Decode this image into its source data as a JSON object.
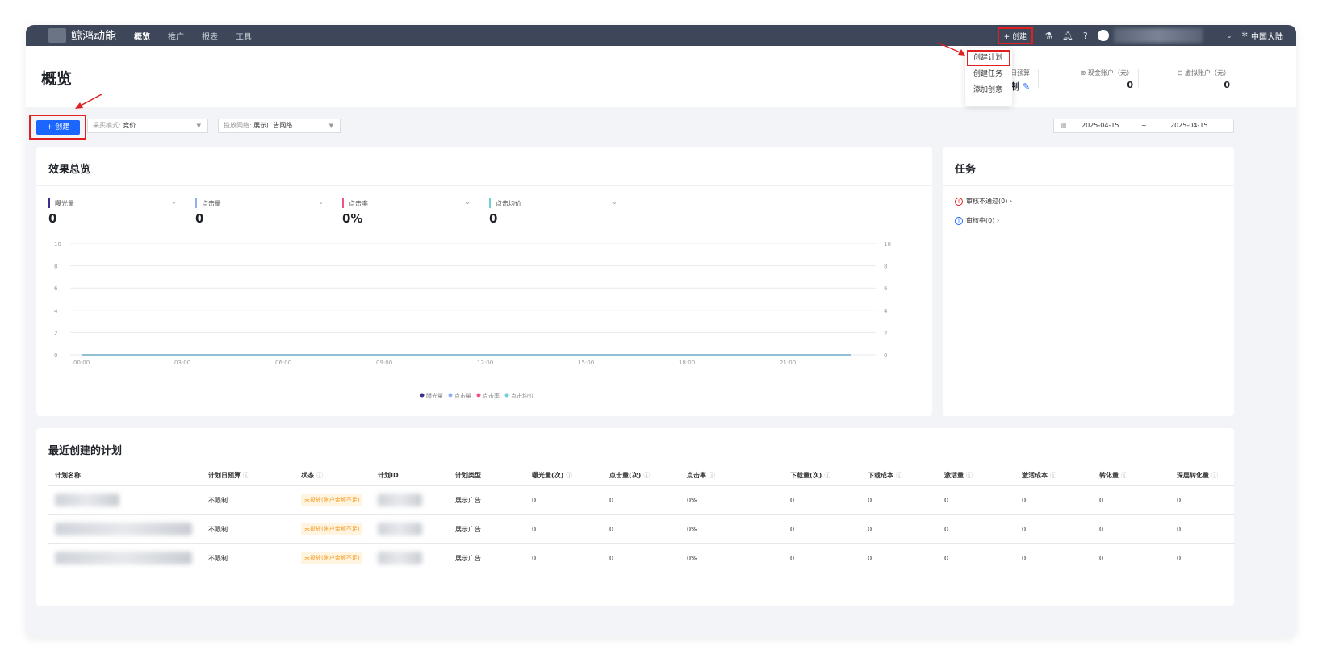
{
  "nav": {
    "brand": "鲸鸿动能",
    "tabs": [
      "概览",
      "推广",
      "报表",
      "工具"
    ],
    "create": "+ 创建",
    "region": "中国大陆"
  },
  "dropdown": {
    "items": [
      "创建计划",
      "创建任务",
      "添加创意"
    ]
  },
  "header": {
    "title": "概览",
    "budget_label": "日预算",
    "budget_value": "制",
    "cash_label": "现金账户（元）",
    "cash_value": "0",
    "virtual_label": "虚拟账户（元）",
    "virtual_value": "0"
  },
  "toolbar": {
    "create": "+ 创建",
    "buy_mode_label": "采买模式:",
    "buy_mode_value": "竞价",
    "network_label": "投放网络:",
    "network_value": "展示广告网络",
    "date_start": "2025-04-15",
    "date_sep": "~",
    "date_end": "2025-04-15"
  },
  "overview": {
    "title": "效果总览",
    "metrics": [
      {
        "label": "曝光量",
        "value": "0",
        "color": "#3d2d8f"
      },
      {
        "label": "点击量",
        "value": "0",
        "color": "#8fb0ef"
      },
      {
        "label": "点击率",
        "value": "0%",
        "color": "#f0508c"
      },
      {
        "label": "点击均价",
        "value": "0",
        "color": "#6fd0d8"
      }
    ]
  },
  "chart_data": {
    "type": "line",
    "x": [
      "00:00",
      "03:00",
      "06:00",
      "09:00",
      "12:00",
      "15:00",
      "18:00",
      "21:00"
    ],
    "ylim": [
      0,
      10
    ],
    "yticks": [
      0,
      2,
      4,
      6,
      8,
      10
    ],
    "series": [
      {
        "name": "曝光量",
        "color": "#3d2d8f",
        "values": [
          0,
          0,
          0,
          0,
          0,
          0,
          0,
          0
        ]
      },
      {
        "name": "点击量",
        "color": "#8fb0ef",
        "values": [
          0,
          0,
          0,
          0,
          0,
          0,
          0,
          0
        ]
      },
      {
        "name": "点击率",
        "color": "#f0508c",
        "values": [
          0,
          0,
          0,
          0,
          0,
          0,
          0,
          0
        ]
      },
      {
        "name": "点击均价",
        "color": "#6fd0d8",
        "values": [
          0,
          0,
          0,
          0,
          0,
          0,
          0,
          0
        ]
      }
    ],
    "legend": "bottom-center",
    "grid": true
  },
  "tasks": {
    "title": "任务",
    "items": [
      {
        "label": "审核不通过(0)",
        "color": "#e02020",
        "icon": "!"
      },
      {
        "label": "审核中(0)",
        "color": "#1a66ff",
        "icon": "i"
      }
    ]
  },
  "plans": {
    "title": "最近创建的计划",
    "columns": [
      "计划名称",
      "计划日预算",
      "状态",
      "计划ID",
      "计划类型",
      "曝光量(次)",
      "点击量(次)",
      "点击率",
      "下载量(次)",
      "下载成本",
      "激活量",
      "激活成本",
      "转化量",
      "深层转化量"
    ],
    "rows": [
      {
        "budget": "不限制",
        "status": "未投放(账户余额不足)",
        "type": "展示广告",
        "imp": "0",
        "clk": "0",
        "ctr": "0%",
        "dl": "0",
        "dlc": "0",
        "act": "0",
        "actc": "0",
        "conv": "0",
        "deep": "0"
      },
      {
        "budget": "不限制",
        "status": "未投放(账户余额不足)",
        "type": "展示广告",
        "imp": "0",
        "clk": "0",
        "ctr": "0%",
        "dl": "0",
        "dlc": "0",
        "act": "0",
        "actc": "0",
        "conv": "0",
        "deep": "0"
      },
      {
        "budget": "不限制",
        "status": "未投放(账户余额不足)",
        "type": "展示广告",
        "imp": "0",
        "clk": "0",
        "ctr": "0%",
        "dl": "0",
        "dlc": "0",
        "act": "0",
        "actc": "0",
        "conv": "0",
        "deep": "0"
      }
    ]
  }
}
